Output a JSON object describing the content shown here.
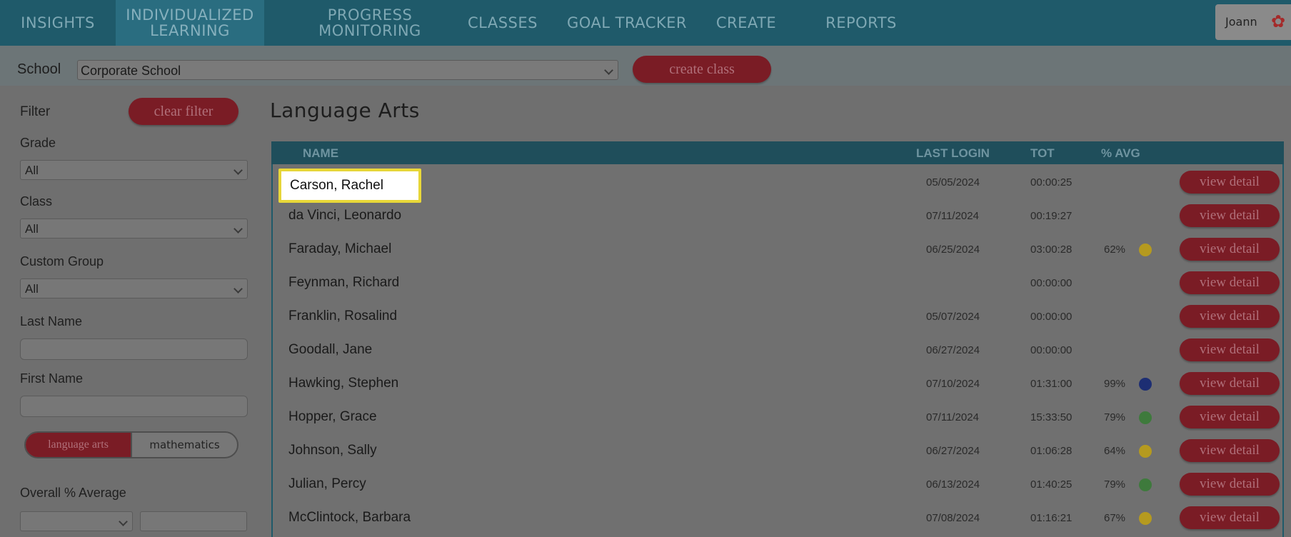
{
  "nav": {
    "items": [
      {
        "label": "INSIGHTS"
      },
      {
        "label": "INDIVIDUALIZED\nLEARNING"
      },
      {
        "label": "PROGRESS\nMONITORING"
      },
      {
        "label": "CLASSES"
      },
      {
        "label": "GOAL TRACKER"
      },
      {
        "label": "CREATE"
      },
      {
        "label": "REPORTS"
      }
    ],
    "active_index": 1,
    "user_name": "Joann"
  },
  "schoolbar": {
    "label": "School",
    "selected": "Corporate School",
    "create_class": "create class"
  },
  "sidebar": {
    "filter_label": "Filter",
    "clear_filter": "clear filter",
    "grade_label": "Grade",
    "grade_value": "All",
    "class_label": "Class",
    "class_value": "All",
    "custom_group_label": "Custom Group",
    "custom_group_value": "All",
    "last_name_label": "Last Name",
    "first_name_label": "First Name",
    "subject_on": "language arts",
    "subject_off": "mathematics",
    "overall_label": "Overall % Average"
  },
  "main": {
    "title": "Language Arts",
    "columns": {
      "name": "NAME",
      "last_login": "LAST LOGIN",
      "tot": "TOT",
      "avg": "% AVG"
    },
    "view_label": "view detail",
    "rows": [
      {
        "name": "Carson, Rachel",
        "last_login": "05/05/2024",
        "tot": "00:00:25",
        "avg": "",
        "dot": ""
      },
      {
        "name": "da Vinci, Leonardo",
        "last_login": "07/11/2024",
        "tot": "00:19:27",
        "avg": "",
        "dot": ""
      },
      {
        "name": "Faraday, Michael",
        "last_login": "06/25/2024",
        "tot": "03:00:28",
        "avg": "62%",
        "dot": "#b59a1f"
      },
      {
        "name": "Feynman, Richard",
        "last_login": "",
        "tot": "00:00:00",
        "avg": "",
        "dot": ""
      },
      {
        "name": "Franklin, Rosalind",
        "last_login": "05/07/2024",
        "tot": "00:00:00",
        "avg": "",
        "dot": ""
      },
      {
        "name": "Goodall, Jane",
        "last_login": "06/27/2024",
        "tot": "00:00:00",
        "avg": "",
        "dot": ""
      },
      {
        "name": "Hawking, Stephen",
        "last_login": "07/10/2024",
        "tot": "01:31:00",
        "avg": "99%",
        "dot": "#1d2e73"
      },
      {
        "name": "Hopper, Grace",
        "last_login": "07/11/2024",
        "tot": "15:33:50",
        "avg": "79%",
        "dot": "#3e7a3c"
      },
      {
        "name": "Johnson, Sally",
        "last_login": "06/27/2024",
        "tot": "01:06:28",
        "avg": "64%",
        "dot": "#b59a1f"
      },
      {
        "name": "Julian, Percy",
        "last_login": "06/13/2024",
        "tot": "01:40:25",
        "avg": "79%",
        "dot": "#3e7a3c"
      },
      {
        "name": "McClintock, Barbara",
        "last_login": "07/08/2024",
        "tot": "01:16:21",
        "avg": "67%",
        "dot": "#b59a1f"
      }
    ]
  },
  "colors": {
    "nav_bg": "#1f5a6a",
    "accent_red": "#7a1c25",
    "highlight_border": "#e8d738"
  }
}
